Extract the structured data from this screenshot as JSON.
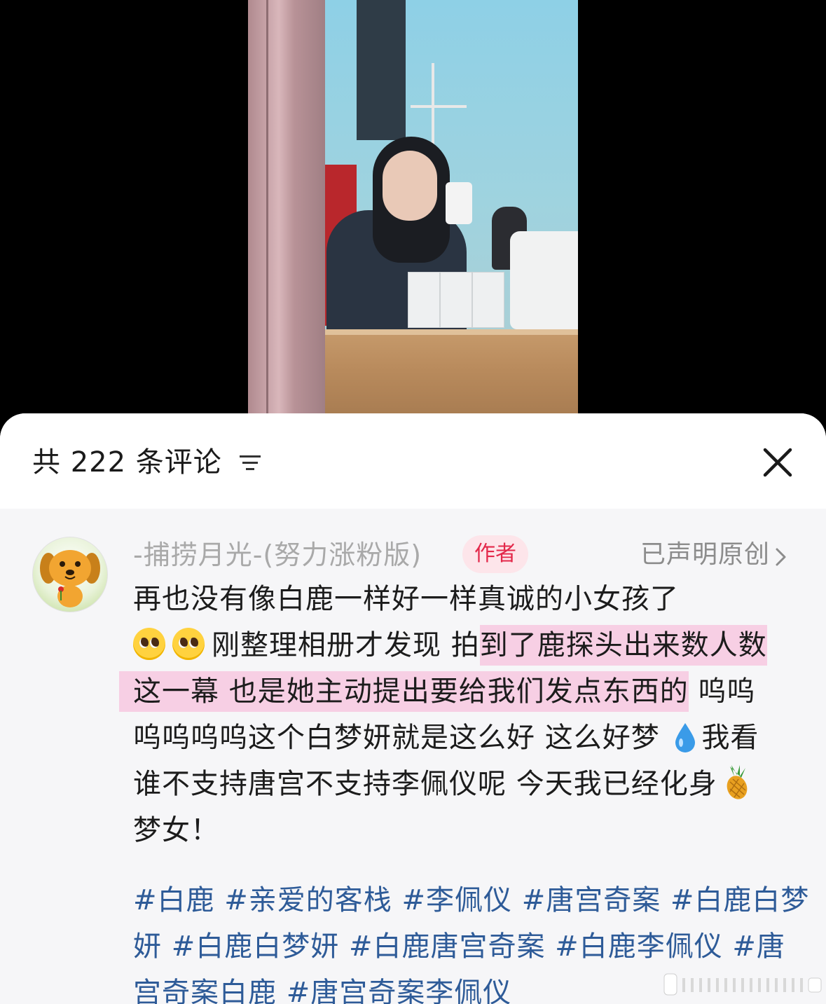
{
  "header": {
    "count_prefix": "共",
    "count": "222",
    "count_suffix": "条评论"
  },
  "comment": {
    "username": "-捕捞月光-(努力涨粉版)",
    "badge": "作者",
    "original_label": "已声明原创",
    "lines": [
      {
        "text": "再也没有像白鹿一样好一样真诚的小女孩了"
      },
      {
        "pre": "刚整理相册才发现 拍",
        "hl": "到了鹿探头出来数人数"
      },
      {
        "hl": "这一幕 也是她主动提出要给我们发点东西的",
        "post": " 呜呜"
      },
      {
        "pre": "呜呜呜呜这个白梦妍就是这么好 这么好梦",
        "post": "我看"
      },
      {
        "pre": "谁不支持唐宫不支持李佩仪呢 今天我已经化身"
      },
      {
        "pre": "梦女！"
      }
    ],
    "tags": [
      "#白鹿 #亲爱的客栈 #李佩仪 #唐宫奇案 #白鹿白梦",
      "妍 #白鹿白梦妍 #白鹿唐宫奇案 #白鹿李佩仪 #唐",
      "宫奇案白鹿 #唐宫奇案李佩仪"
    ]
  },
  "icons": {
    "sort": "sort-icon",
    "close": "close-icon",
    "chevron": "chevron-right-icon",
    "emoji_1": "pleading-face-icon",
    "emoji_2": "droplet-icon",
    "emoji_3": "pineapple-icon"
  },
  "colors": {
    "tag": "#2e5b98",
    "badge_text": "#e3284a",
    "badge_bg": "#fde5ea",
    "highlight": "#f7cfe4",
    "sheet_bg": "#f6f6f8"
  }
}
